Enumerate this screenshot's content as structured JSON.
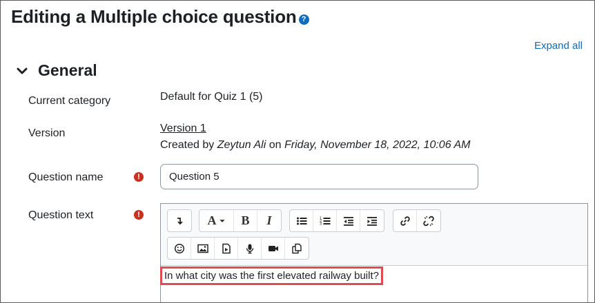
{
  "page": {
    "title": "Editing a Multiple choice question",
    "expand_all": "Expand all"
  },
  "section": {
    "title": "General"
  },
  "fields": {
    "category_label": "Current category",
    "category_value": "Default for Quiz 1 (5)",
    "version_label": "Version",
    "version_link": "Version 1",
    "created_by_prefix": "Created by",
    "created_by_name": "Zeytun Ali",
    "created_on_word": "on",
    "created_on_date": "Friday, November 18, 2022, 10:06 AM",
    "qname_label": "Question name",
    "qname_value": "Question 5",
    "qtext_label": "Question text",
    "qtext_value": "In what city was the first elevated railway built?"
  },
  "toolbar": {
    "row1": [
      "show-more-buttons",
      "font-color",
      "bold",
      "italic",
      "unordered-list",
      "ordered-list",
      "outdent",
      "indent",
      "link",
      "unlink"
    ],
    "row2": [
      "emoji",
      "image",
      "media",
      "record-audio",
      "record-video",
      "manage-files"
    ],
    "bold_glyph": "B",
    "italic_glyph": "I",
    "font_glyph": "A"
  },
  "colors": {
    "accent": "#0f6cbf",
    "required": "#ca3120",
    "highlight": "#e04b52"
  }
}
